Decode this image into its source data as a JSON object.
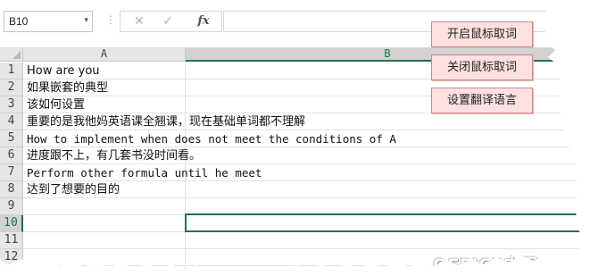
{
  "formula_bar": {
    "name_box": "B10",
    "name_box_arrow": "▾",
    "divider": "⋮",
    "cancel_icon": "✕",
    "enter_icon": "✓",
    "fx_label": "fx",
    "formula": ""
  },
  "columns": [
    "A",
    "B"
  ],
  "rows": [
    {
      "num": "1",
      "a": "How are you"
    },
    {
      "num": "2",
      "a": "如果嵌套的典型"
    },
    {
      "num": "3",
      "a": "该如何设置"
    },
    {
      "num": "4",
      "a": "重要的是我他妈英语课全翘课，现在基础单词都不理解"
    },
    {
      "num": "5",
      "a": "How to implement when does not meet the conditions of A"
    },
    {
      "num": "6",
      "a": "进度跟不上，有几套书没时间看。"
    },
    {
      "num": "7",
      "a": "Perform other formula until he meet"
    },
    {
      "num": "8",
      "a": "达到了想要的目的"
    },
    {
      "num": "9",
      "a": ""
    },
    {
      "num": "10",
      "a": ""
    },
    {
      "num": "11",
      "a": ""
    },
    {
      "num": "12",
      "a": ""
    }
  ],
  "selected_row": "10",
  "macro_buttons": {
    "enable": "开启鼠标取词",
    "disable": "关闭鼠标取词",
    "language": "设置翻译语言"
  },
  "watermark": "OFFICE中国",
  "colors": {
    "selection": "#217346",
    "button_bg": "#fde0e0"
  }
}
